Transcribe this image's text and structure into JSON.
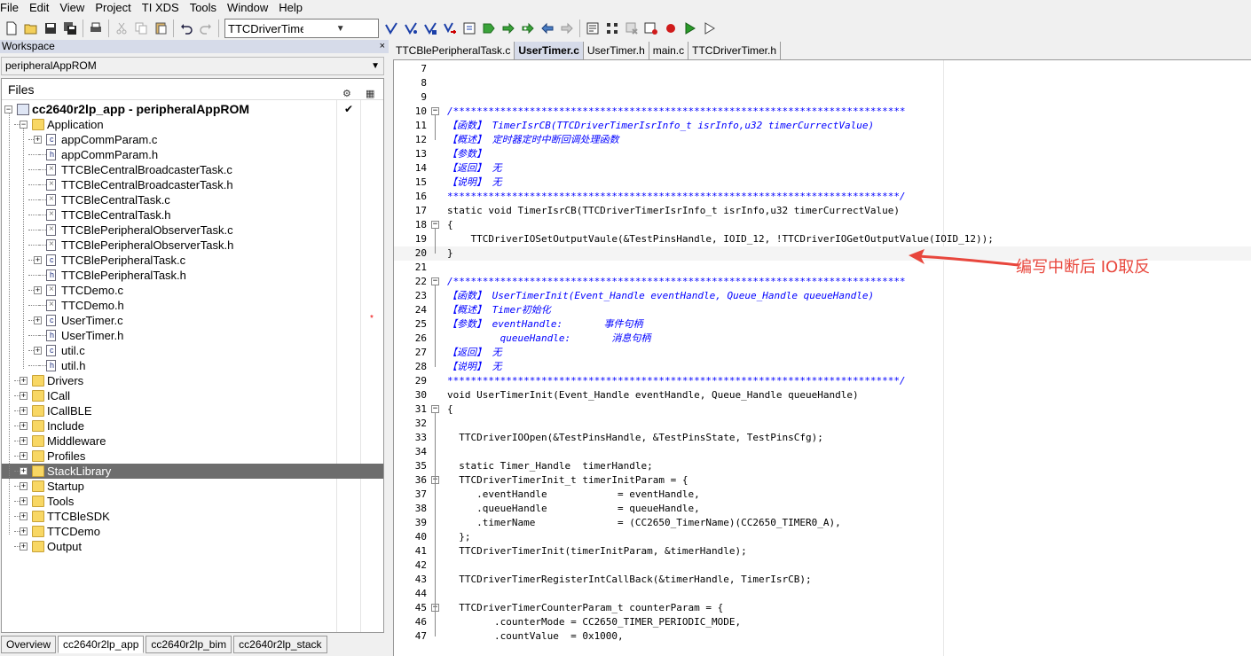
{
  "menu": [
    "File",
    "Edit",
    "View",
    "Project",
    "TI XDS",
    "Tools",
    "Window",
    "Help"
  ],
  "toolbar": {
    "config_combo": "TTCDriverTimerCounterPa"
  },
  "workspace": {
    "title": "Workspace",
    "close": "×",
    "config": "peripheralAppROM",
    "files_header": "Files",
    "project": "cc2640r2lp_app - peripheralAppROM",
    "project_check": "✔",
    "tree": [
      {
        "label": "Application"
      },
      {
        "label": "appCommParam.c"
      },
      {
        "label": "appCommParam.h"
      },
      {
        "label": "TTCBleCentralBroadcasterTask.c"
      },
      {
        "label": "TTCBleCentralBroadcasterTask.h"
      },
      {
        "label": "TTCBleCentralTask.c"
      },
      {
        "label": "TTCBleCentralTask.h"
      },
      {
        "label": "TTCBlePeripheralObserverTask.c"
      },
      {
        "label": "TTCBlePeripheralObserverTask.h"
      },
      {
        "label": "TTCBlePeripheralTask.c"
      },
      {
        "label": "TTCBlePeripheralTask.h"
      },
      {
        "label": "TTCDemo.c"
      },
      {
        "label": "TTCDemo.h"
      },
      {
        "label": "UserTimer.c",
        "modified": "*"
      },
      {
        "label": "UserTimer.h"
      },
      {
        "label": "util.c"
      },
      {
        "label": "util.h"
      },
      {
        "label": "Drivers"
      },
      {
        "label": "ICall"
      },
      {
        "label": "ICallBLE"
      },
      {
        "label": "Include"
      },
      {
        "label": "Middleware"
      },
      {
        "label": "Profiles"
      },
      {
        "label": "StackLibrary"
      },
      {
        "label": "Startup"
      },
      {
        "label": "Tools"
      },
      {
        "label": "TTCBleSDK"
      },
      {
        "label": "TTCDemo"
      },
      {
        "label": "Output"
      }
    ],
    "tabs": [
      "Overview",
      "cc2640r2lp_app",
      "cc2640r2lp_bim",
      "cc2640r2lp_stack"
    ]
  },
  "editor": {
    "tabs": [
      "TTCBlePeripheralTask.c",
      "UserTimer.c",
      "UserTimer.h",
      "main.c",
      "TTCDriverTimer.h"
    ],
    "lines": [
      {
        "n": "7",
        "t": ""
      },
      {
        "n": "8",
        "t": ""
      },
      {
        "n": "9",
        "t": ""
      },
      {
        "n": "10",
        "t": "/*****************************************************************************"
      },
      {
        "n": "11",
        "t": "【函数】 TimerIsrCB(TTCDriverTimerIsrInfo_t isrInfo,u32 timerCurrectValue)"
      },
      {
        "n": "12",
        "t": "【概述】 定时器定时中断回调处理函数"
      },
      {
        "n": "13",
        "t": "【参数】"
      },
      {
        "n": "14",
        "t": "【返回】 无"
      },
      {
        "n": "15",
        "t": "【说明】 无"
      },
      {
        "n": "16",
        "t": "*****************************************************************************/"
      },
      {
        "n": "17",
        "t": "static void TimerIsrCB(TTCDriverTimerIsrInfo_t isrInfo,u32 timerCurrectValue)"
      },
      {
        "n": "18",
        "t": "{"
      },
      {
        "n": "19",
        "t": "    TTCDriverIOSetOutputVaule(&TestPinsHandle, IOID_12, !TTCDriverIOGetOutputValue(IOID_12));"
      },
      {
        "n": "20",
        "t": "}"
      },
      {
        "n": "21",
        "t": ""
      },
      {
        "n": "22",
        "t": "/*****************************************************************************"
      },
      {
        "n": "23",
        "t": "【函数】 UserTimerInit(Event_Handle eventHandle, Queue_Handle queueHandle)"
      },
      {
        "n": "24",
        "t": "【概述】 Timer初始化"
      },
      {
        "n": "25",
        "t": "【参数】 eventHandle:       事件句柄"
      },
      {
        "n": "26",
        "t": "         queueHandle:       消息句柄"
      },
      {
        "n": "27",
        "t": "【返回】 无"
      },
      {
        "n": "28",
        "t": "【说明】 无"
      },
      {
        "n": "29",
        "t": "*****************************************************************************/"
      },
      {
        "n": "30",
        "t": "void UserTimerInit(Event_Handle eventHandle, Queue_Handle queueHandle)"
      },
      {
        "n": "31",
        "t": "{"
      },
      {
        "n": "32",
        "t": ""
      },
      {
        "n": "33",
        "t": "  TTCDriverIOOpen(&TestPinsHandle, &TestPinsState, TestPinsCfg);"
      },
      {
        "n": "34",
        "t": ""
      },
      {
        "n": "35",
        "t": "  static Timer_Handle  timerHandle;"
      },
      {
        "n": "36",
        "t": "  TTCDriverTimerInit_t timerInitParam = {"
      },
      {
        "n": "37",
        "t": "     .eventHandle            = eventHandle,"
      },
      {
        "n": "38",
        "t": "     .queueHandle            = queueHandle,"
      },
      {
        "n": "39",
        "t": "     .timerName              = (CC2650_TimerName)(CC2650_TIMER0_A),"
      },
      {
        "n": "40",
        "t": "  };"
      },
      {
        "n": "41",
        "t": "  TTCDriverTimerInit(timerInitParam, &timerHandle);"
      },
      {
        "n": "42",
        "t": ""
      },
      {
        "n": "43",
        "t": "  TTCDriverTimerRegisterIntCallBack(&timerHandle, TimerIsrCB);"
      },
      {
        "n": "44",
        "t": ""
      },
      {
        "n": "45",
        "t": "  TTCDriverTimerCounterParam_t counterParam = {"
      },
      {
        "n": "46",
        "t": "        .counterMode = CC2650_TIMER_PERIODIC_MODE,"
      },
      {
        "n": "47",
        "t": "        .countValue  = 0x1000,"
      }
    ]
  },
  "annotation": {
    "text": "编写中断后 IO取反",
    "color": "#e8463c"
  }
}
